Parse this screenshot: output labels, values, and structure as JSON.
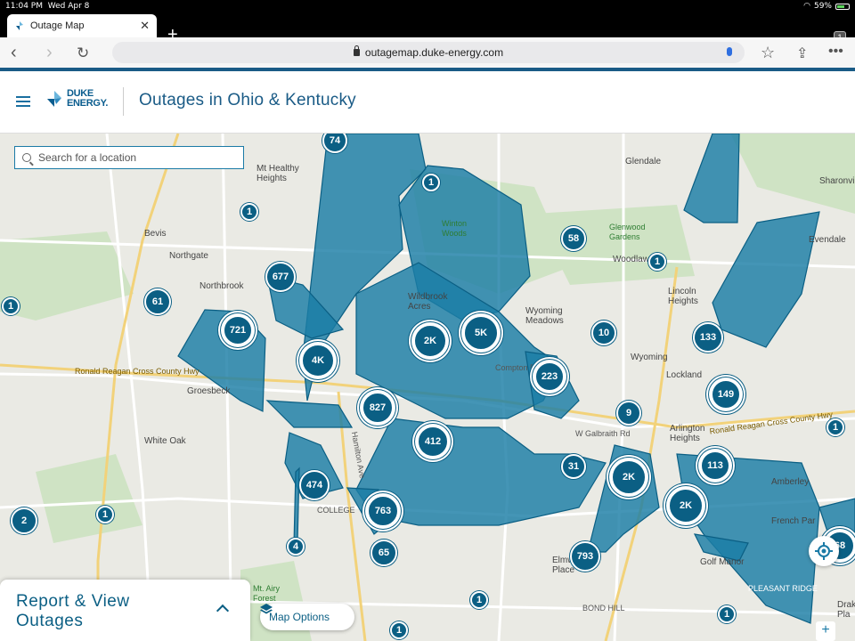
{
  "status_bar": {
    "time": "11:04 PM",
    "date": "Wed Apr 8",
    "battery": "59%"
  },
  "browser": {
    "tab_title": "Outage Map",
    "tab_count": "1",
    "url": "outagemap.duke-energy.com"
  },
  "header": {
    "logo_line1": "DUKE",
    "logo_line2": "ENERGY.",
    "title": "Outages in Ohio & Kentucky"
  },
  "search": {
    "placeholder": "Search for a location"
  },
  "clusters": [
    {
      "label": "74"
    },
    {
      "label": "1"
    },
    {
      "label": "1"
    },
    {
      "label": "58"
    },
    {
      "label": "677"
    },
    {
      "label": "61"
    },
    {
      "label": "1"
    },
    {
      "label": "721"
    },
    {
      "label": "4K"
    },
    {
      "label": "2K"
    },
    {
      "label": "5K"
    },
    {
      "label": "1"
    },
    {
      "label": "133"
    },
    {
      "label": "10"
    },
    {
      "label": "223"
    },
    {
      "label": "149"
    },
    {
      "label": "827"
    },
    {
      "label": "9"
    },
    {
      "label": "412"
    },
    {
      "label": "1"
    },
    {
      "label": "31"
    },
    {
      "label": "2K"
    },
    {
      "label": "113"
    },
    {
      "label": "474"
    },
    {
      "label": "2K"
    },
    {
      "label": "763"
    },
    {
      "label": "2"
    },
    {
      "label": "1"
    },
    {
      "label": "4"
    },
    {
      "label": "65"
    },
    {
      "label": "793"
    },
    {
      "label": "1"
    },
    {
      "label": "1"
    },
    {
      "label": "1"
    },
    {
      "label": "1"
    },
    {
      "label": "68"
    }
  ],
  "map_labels": {
    "mt_healthy": "Mt Healthy\nHeights",
    "bevis": "Bevis",
    "northgate": "Northgate",
    "northbrook": "Northbrook",
    "winton_woods": "Winton\nWoods",
    "wildbrook": "Wildbrook\nAcres",
    "glendale": "Glendale",
    "glenwood": "Glenwood\nGardens",
    "woodlawn": "Woodlaw",
    "lincoln": "Lincoln\nHeights",
    "evendale": "Evendale",
    "sharonville": "Sharonvil",
    "wyoming_meadows": "Wyoming\nMeadows",
    "wyoming": "Wyoming",
    "lockland": "Lockland",
    "groesbeck": "Groesbeck",
    "white_oak": "White Oak",
    "arlington": "Arlington\nHeights",
    "college": "COLLEGE",
    "amberley": "Amberley",
    "french_park": "French Par",
    "golf_manor": "Golf Manor",
    "elmwood": "Elmwo\nPlace",
    "bond_hill": "BOND HILL",
    "mt_airy": "Mt. Airy\nForest",
    "pleasant_ridge": "PLEASANT RIDGE",
    "ronald_reagan": "Ronald Reagan Cross County Hwy",
    "ronald_reagan_e": "Ronald Reagan Cross County Hwy",
    "hamilton_ave": "Hamilton Ave",
    "compton": "Compton Rd",
    "galbraith": "W Galbraith Rd",
    "drake": "Drak\nPla"
  },
  "report_panel": {
    "title": "Report & View Outages"
  },
  "map_options": {
    "label": "Map Options"
  },
  "colors": {
    "brand": "#0b5f84",
    "outage_fill": "#1b7ea6",
    "accent": "#1a5b86"
  }
}
